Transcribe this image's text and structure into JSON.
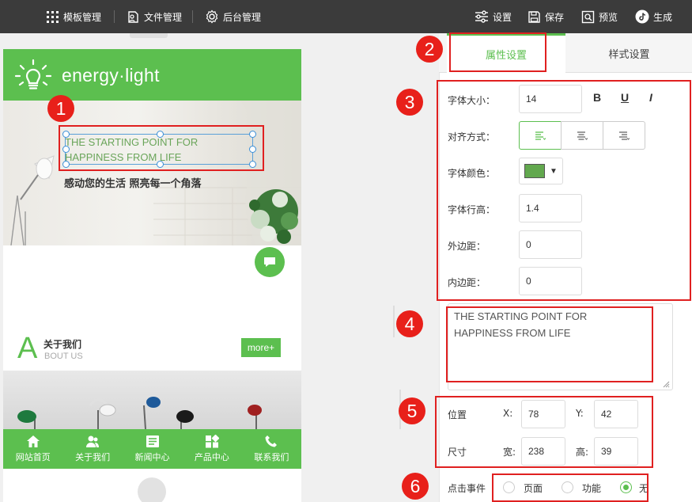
{
  "topbar": {
    "template_manage": "模板管理",
    "file_manage": "文件管理",
    "backend_manage": "后台管理",
    "settings": "设置",
    "save": "保存",
    "preview": "预览",
    "generate": "生成"
  },
  "phone": {
    "app_title": "energy·light",
    "banner_heading": "THE STARTING POINT FOR HAPPINESS FROM LIFE",
    "banner_subtitle": "感动您的生活 照亮每一个角落",
    "about": {
      "letter": "A",
      "title": "关于我们",
      "subtitle": "BOUT US",
      "more": "more+"
    },
    "nav": [
      {
        "label": "网站首页",
        "icon": "home-icon"
      },
      {
        "label": "关于我们",
        "icon": "users-icon"
      },
      {
        "label": "新闻中心",
        "icon": "news-icon"
      },
      {
        "label": "产品中心",
        "icon": "grid-icon"
      },
      {
        "label": "联系我们",
        "icon": "phone-icon"
      }
    ]
  },
  "annotations": [
    "1",
    "2",
    "3",
    "4",
    "5",
    "6"
  ],
  "panel": {
    "tabs": {
      "attributes": "属性设置",
      "styles": "样式设置"
    },
    "font_size_label": "字体大小：",
    "font_size": "14",
    "bold": "B",
    "underline": "U",
    "italic": "I",
    "align_label": "对齐方式：",
    "color_label": "字体颜色：",
    "font_color": "#62a84e",
    "line_height_label": "字体行高：",
    "line_height": "1.4",
    "margin_label": "外边距：",
    "margin": "0",
    "padding_label": "内边距：",
    "padding": "0",
    "text_content": "THE STARTING POINT FOR HAPPINESS FROM LIFE",
    "position_label": "位置",
    "x_label": "X:",
    "x": "78",
    "y_label": "Y:",
    "y": "42",
    "size_label": "尺寸",
    "width_label": "宽:",
    "width": "238",
    "height_label": "高:",
    "height": "39",
    "click_label": "点击事件",
    "click_options": [
      "页面",
      "功能",
      "无"
    ],
    "click_selected": "无"
  },
  "colors": {
    "accent_green": "#5cbf4f",
    "annotation_red": "#e8201a",
    "topbar": "#3b3b3b"
  }
}
